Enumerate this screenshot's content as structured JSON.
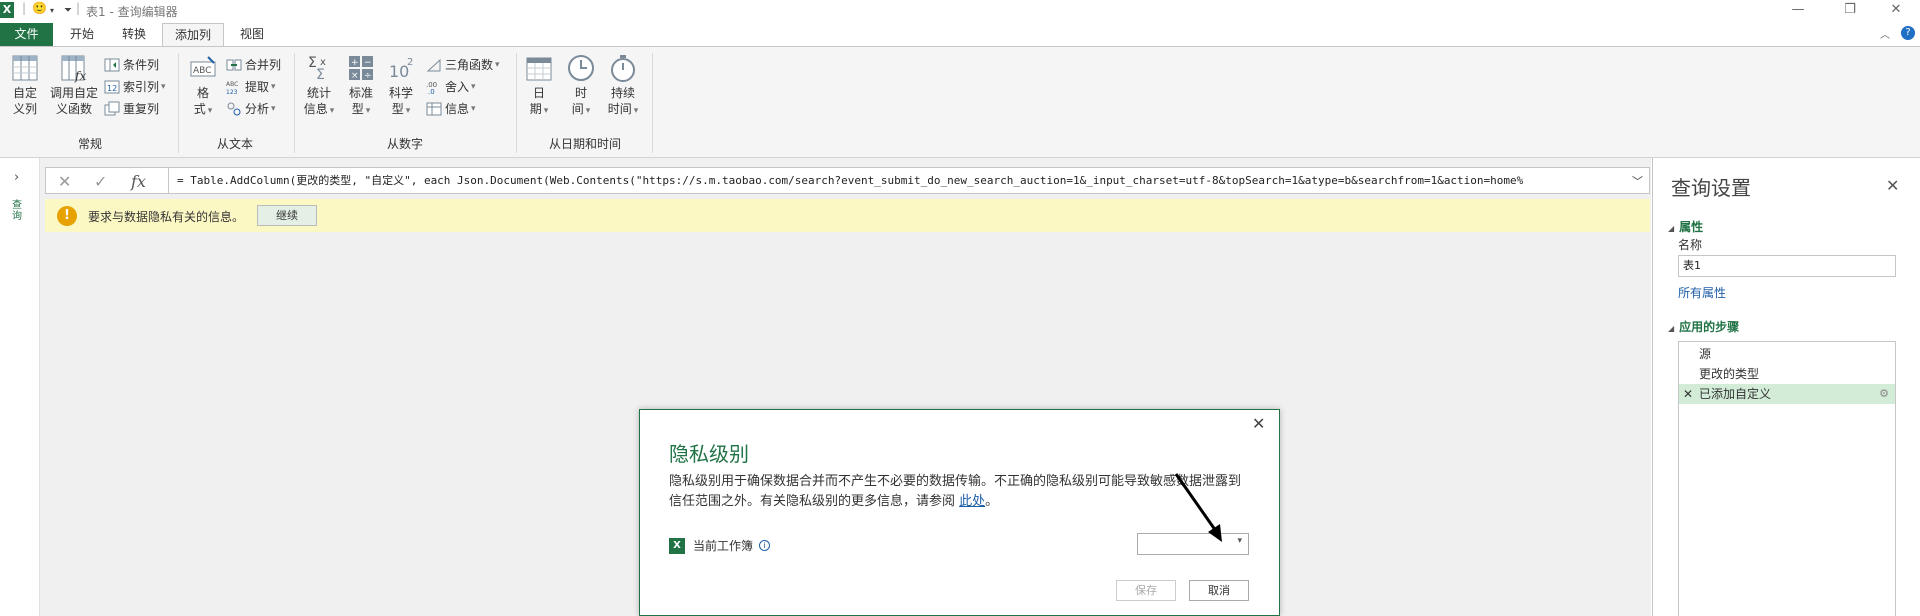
{
  "titlebar": {
    "app_icon": "X",
    "smiley": "🙂",
    "window_title": "表1 - 查询编辑器"
  },
  "tabs": [
    "文件",
    "开始",
    "转换",
    "添加列",
    "视图"
  ],
  "ribbon": {
    "general": {
      "label": "常规",
      "custom_column": [
        "自定",
        "义列"
      ],
      "invoke_custom_function": [
        "调用自定",
        "义函数"
      ],
      "conditional_column": "条件列",
      "index_column": "索引列",
      "duplicate_column": "重复列"
    },
    "from_text": {
      "label": "从文本",
      "format": [
        "格",
        "式"
      ],
      "merge_columns": "合并列",
      "extract": "提取",
      "parse": "分析"
    },
    "from_number": {
      "label": "从数字",
      "statistics": [
        "统计",
        "信息"
      ],
      "standard": [
        "标准",
        "型"
      ],
      "scientific": [
        "科学",
        "型"
      ],
      "trigonometry": "三角函数",
      "rounding": "舍入",
      "information": "信息"
    },
    "from_datetime": {
      "label": "从日期和时间",
      "date": [
        "日",
        "期"
      ],
      "time": [
        "时",
        "间"
      ],
      "duration": [
        "持续",
        "时间"
      ]
    }
  },
  "left_nav": {
    "label": "查询"
  },
  "formula_bar": {
    "formula": "= Table.AddColumn(更改的类型, \"自定义\", each Json.Document(Web.Contents(\"https://s.m.taobao.com/search?event_submit_do_new_search_auction=1&_input_charset=utf-8&topSearch=1&atype=b&searchfrom=1&action=home%"
  },
  "warning": {
    "text": "要求与数据隐私有关的信息。",
    "button": "继续"
  },
  "query_settings": {
    "title": "查询设置",
    "properties_header": "属性",
    "name_label": "名称",
    "name_value": "表1",
    "all_properties_link": "所有属性",
    "applied_steps_header": "应用的步骤",
    "steps": [
      "源",
      "更改的类型",
      "已添加自定义"
    ]
  },
  "dialog": {
    "title": "隐私级别",
    "description": "隐私级别用于确保数据合并而不产生不必要的数据传输。不正确的隐私级别可能导致敏感数据泄露到信任范围之外。有关隐私级别的更多信息，请参阅",
    "link": "此处",
    "period": "。",
    "workbook_label": "当前工作簿",
    "level_value": "",
    "save_button": "保存",
    "cancel_button": "取消"
  }
}
